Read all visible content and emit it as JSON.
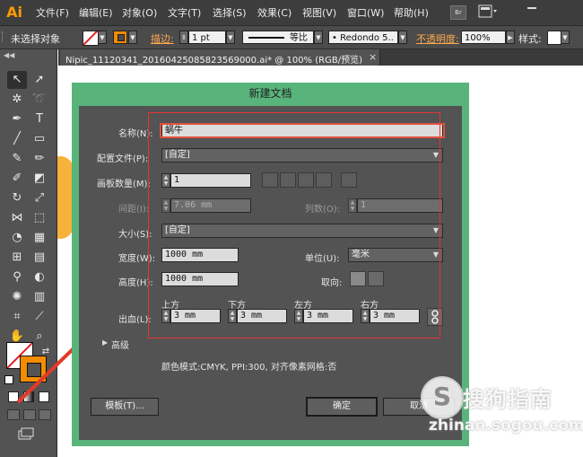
{
  "app": {
    "logo": "Ai",
    "accent": "#ff9a00"
  },
  "menubar": {
    "items": [
      "文件(F)",
      "编辑(E)",
      "对象(O)",
      "文字(T)",
      "选择(S)",
      "效果(C)",
      "视图(V)",
      "窗口(W)",
      "帮助(H)"
    ],
    "bridge_icon": "Br"
  },
  "controlbar": {
    "selection_status": "未选择对象",
    "stroke_label": "描边:",
    "stroke_weight": "1 pt",
    "profile": "等比",
    "brush": "• Redondo 5..",
    "opacity_label": "不透明度:",
    "opacity": "100%",
    "style_label": "样式:"
  },
  "document_tab": {
    "title": "Nipic_11120341_20160425085823569000.ai* @ 100% (RGB/预览)",
    "close": "×"
  },
  "dialog": {
    "title": "新建文档",
    "name_label": "名称(N):",
    "name_value": "蜗牛",
    "profile_label": "配置文件(P):",
    "profile_value": "[自定]",
    "artboards_label": "画板数量(M):",
    "artboards_value": "1",
    "spacing_label": "间距(I):",
    "spacing_value": "7.06 mm",
    "columns_label": "列数(O):",
    "columns_value": "1",
    "size_label": "大小(S):",
    "size_value": "[自定]",
    "width_label": "宽度(W):",
    "width_value": "1000 mm",
    "units_label": "单位(U):",
    "units_value": "毫米",
    "height_label": "高度(H):",
    "height_value": "1000 mm",
    "orientation_label": "取向:",
    "bleed_label": "出血(L):",
    "bleed_top_label": "上方",
    "bleed_bottom_label": "下方",
    "bleed_left_label": "左方",
    "bleed_right_label": "右方",
    "bleed_top": "3 mm",
    "bleed_bottom": "3 mm",
    "bleed_left": "3 mm",
    "bleed_right": "3 mm",
    "advanced_label": "高级",
    "summary": "颜色模式:CMYK, PPI:300, 对齐像素网格:否",
    "templates_button": "模板(T)...",
    "ok_button": "确定",
    "cancel_button": "取消"
  },
  "watermark": {
    "logo": "S",
    "brand": "搜狗指南",
    "url": "zhinan.sogou.com"
  },
  "colors": {
    "dialog_frame": "#58b47b",
    "highlight": "#e53333",
    "fill_stroke": "#f28c00"
  }
}
